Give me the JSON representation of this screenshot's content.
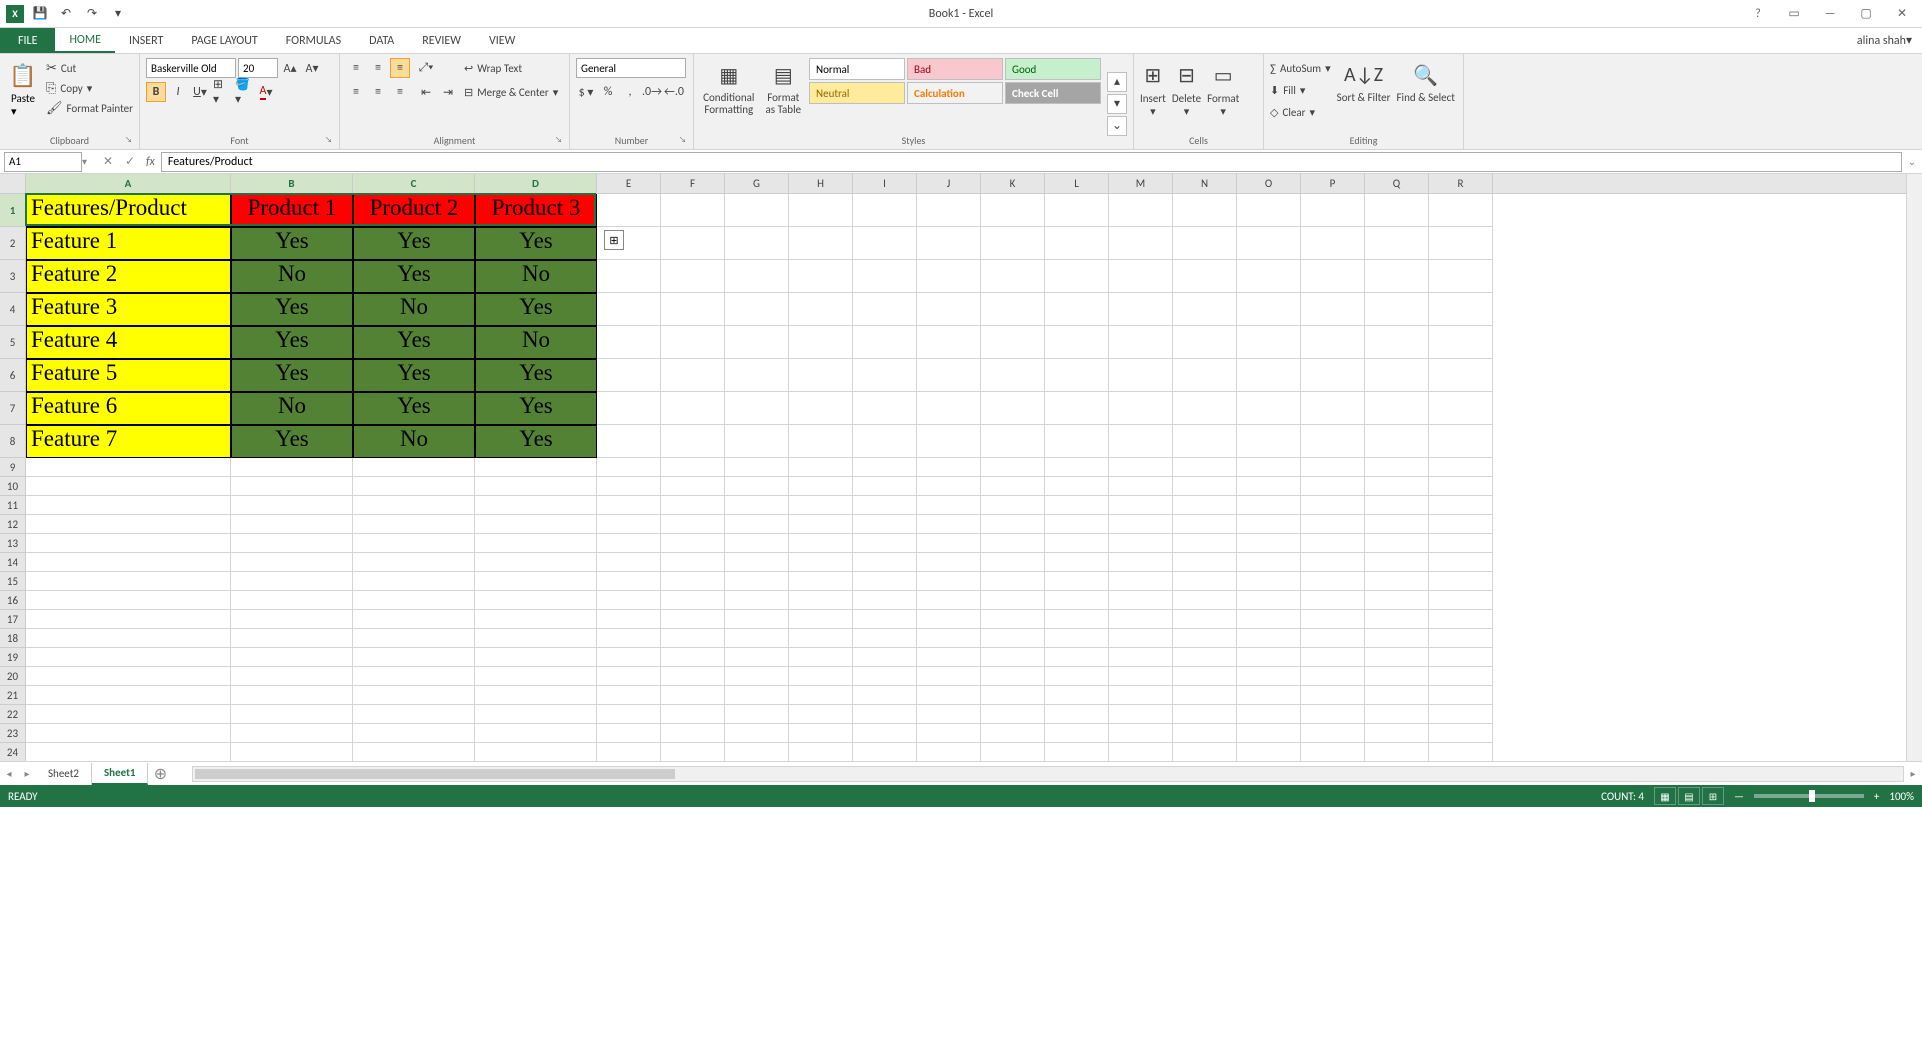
{
  "window": {
    "title": "Book1 - Excel",
    "user": "alina shah"
  },
  "qat": {
    "save": "💾",
    "undo": "↶",
    "redo": "↷"
  },
  "tabs": [
    "FILE",
    "HOME",
    "INSERT",
    "PAGE LAYOUT",
    "FORMULAS",
    "DATA",
    "REVIEW",
    "VIEW"
  ],
  "active_tab": "HOME",
  "ribbon": {
    "clipboard": {
      "label": "Clipboard",
      "paste": "Paste",
      "cut": "Cut",
      "copy": "Copy",
      "fp": "Format Painter"
    },
    "font": {
      "label": "Font",
      "name": "Baskerville Old",
      "size": "20"
    },
    "alignment": {
      "label": "Alignment",
      "wrap": "Wrap Text",
      "merge": "Merge & Center"
    },
    "number": {
      "label": "Number",
      "format": "General"
    },
    "styles": {
      "label": "Styles",
      "cf": "Conditional Formatting",
      "fat": "Format as Table",
      "cells": [
        "Normal",
        "Bad",
        "Good",
        "Neutral",
        "Calculation",
        "Check Cell"
      ]
    },
    "cells": {
      "label": "Cells",
      "insert": "Insert",
      "delete": "Delete",
      "format": "Format"
    },
    "editing": {
      "label": "Editing",
      "autosum": "AutoSum",
      "fill": "Fill",
      "clear": "Clear",
      "sort": "Sort & Filter",
      "find": "Find & Select"
    }
  },
  "namebox": "A1",
  "formula": "Features/Product",
  "columns": [
    "A",
    "B",
    "C",
    "D",
    "E",
    "F",
    "G",
    "H",
    "I",
    "J",
    "K",
    "L",
    "M",
    "N",
    "O",
    "P",
    "Q",
    "R"
  ],
  "col_widths": {
    "A": 205,
    "B": 122,
    "C": 122,
    "D": 122,
    "default": 64
  },
  "chart_data": {
    "type": "table",
    "headers": [
      "Features/Product",
      "Product 1",
      "Product 2",
      "Product 3"
    ],
    "rows": [
      [
        "Feature 1",
        "Yes",
        "Yes",
        "Yes"
      ],
      [
        "Feature 2",
        "No",
        "Yes",
        "No"
      ],
      [
        "Feature 3",
        "Yes",
        "No",
        "Yes"
      ],
      [
        "Feature 4",
        "Yes",
        "Yes",
        "No"
      ],
      [
        "Feature 5",
        "Yes",
        "Yes",
        "Yes"
      ],
      [
        "Feature 6",
        "No",
        "Yes",
        "Yes"
      ],
      [
        "Feature 7",
        "Yes",
        "No",
        "Yes"
      ]
    ]
  },
  "selection": {
    "range": "A1:D1",
    "active": "A1"
  },
  "sheets": [
    "Sheet2",
    "Sheet1"
  ],
  "active_sheet": "Sheet1",
  "status": {
    "ready": "READY",
    "count": "COUNT: 4",
    "zoom": "100%"
  }
}
